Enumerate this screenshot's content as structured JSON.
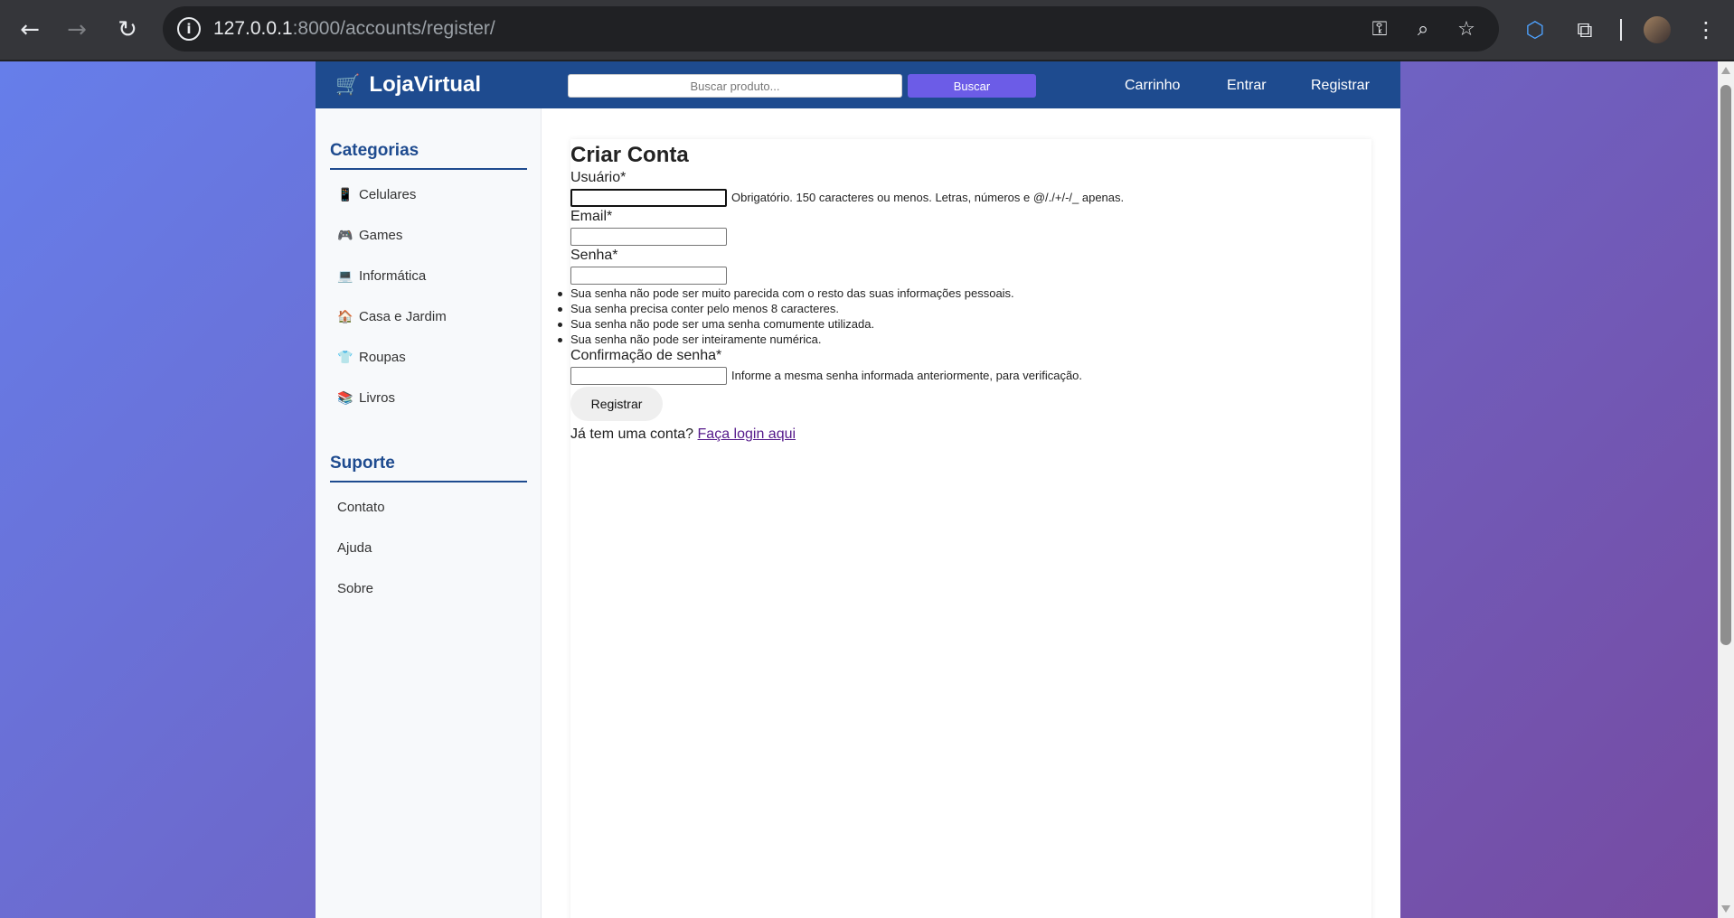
{
  "browser": {
    "url_host": "127.0.0.1",
    "url_rest": ":8000/accounts/register/"
  },
  "header": {
    "logo": "LojaVirtual",
    "search_placeholder": "Buscar produto...",
    "search_button": "Buscar",
    "nav": [
      "Carrinho",
      "Entrar",
      "Registrar"
    ]
  },
  "sidebar": {
    "categories_title": "Categorias",
    "categories": [
      {
        "label": "Celulares",
        "icon": "phone-icon",
        "glyph": "📱"
      },
      {
        "label": "Games",
        "icon": "gamepad-icon",
        "glyph": "🎮"
      },
      {
        "label": "Informática",
        "icon": "laptop-icon",
        "glyph": "💻"
      },
      {
        "label": "Casa e Jardim",
        "icon": "house-icon",
        "glyph": "🏠"
      },
      {
        "label": "Roupas",
        "icon": "shirt-icon",
        "glyph": "👕"
      },
      {
        "label": "Livros",
        "icon": "books-icon",
        "glyph": "📚"
      }
    ],
    "support_title": "Suporte",
    "support": [
      "Contato",
      "Ajuda",
      "Sobre"
    ]
  },
  "form": {
    "title": "Criar Conta",
    "username_label": "Usuário*",
    "username_help": "Obrigatório. 150 caracteres ou menos. Letras, números e @/./+/-/_ apenas.",
    "email_label": "Email*",
    "password_label": "Senha*",
    "password_rules": [
      "Sua senha não pode ser muito parecida com o resto das suas informações pessoais.",
      "Sua senha precisa conter pelo menos 8 caracteres.",
      "Sua senha não pode ser uma senha comumente utilizada.",
      "Sua senha não pode ser inteiramente numérica."
    ],
    "confirm_label": "Confirmação de senha*",
    "confirm_help": "Informe a mesma senha informada anteriormente, para verificação.",
    "submit": "Registrar",
    "login_prompt": "Já tem uma conta?",
    "login_link": "Faça login aqui"
  },
  "colors": {
    "header": "#1e4b8f",
    "accent_button": "#6c5ce7",
    "gradient_start": "#667eea",
    "gradient_end": "#764ba2"
  }
}
